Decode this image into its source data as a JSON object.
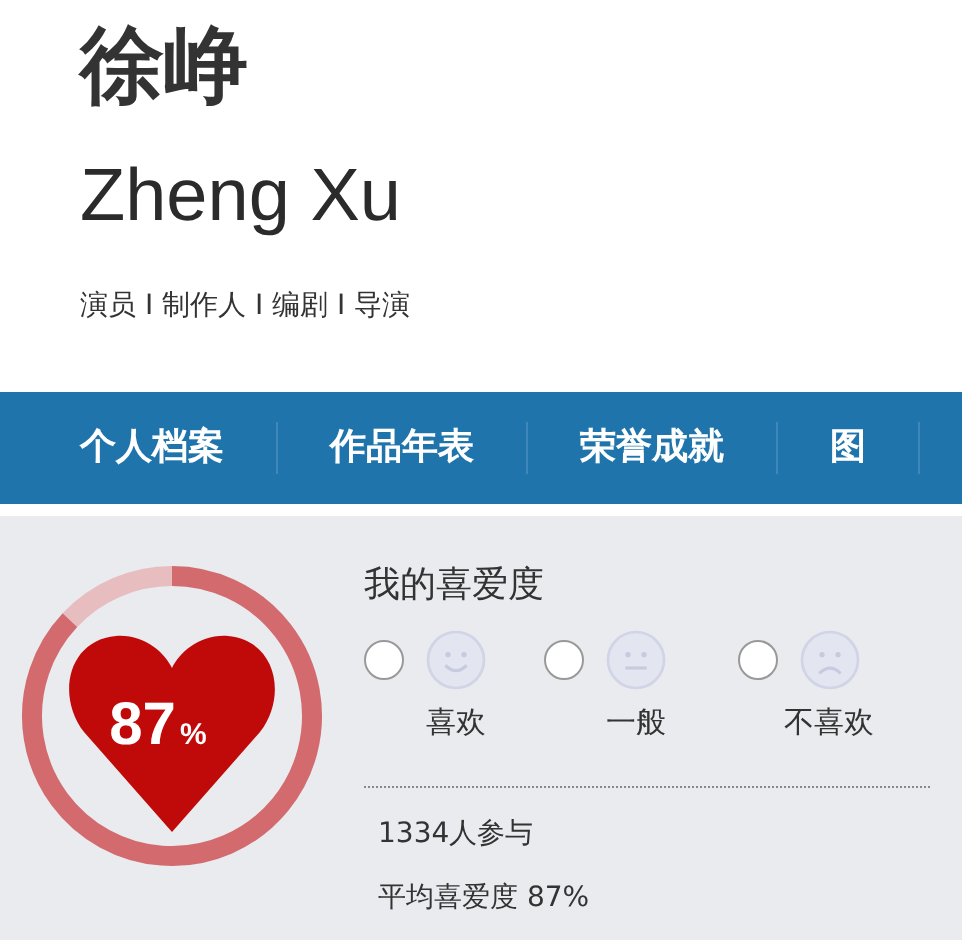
{
  "header": {
    "name": "徐峥",
    "name_latin": "Zheng Xu",
    "roles": "演员 I 制作人 I 编剧 I 导演"
  },
  "nav": [
    {
      "label": "个人档案"
    },
    {
      "label": "作品年表"
    },
    {
      "label": "荣誉成就"
    },
    {
      "label": "图"
    }
  ],
  "rating": {
    "value": "87",
    "unit": "%",
    "title": "我的喜爱度",
    "options": [
      {
        "kind": "smile",
        "label": "喜欢",
        "checked": false
      },
      {
        "kind": "neutral",
        "label": "一般",
        "checked": false
      },
      {
        "kind": "frown",
        "label": "不喜欢",
        "checked": false
      }
    ],
    "participants": "1334人参与",
    "average": "平均喜爱度 87%"
  }
}
